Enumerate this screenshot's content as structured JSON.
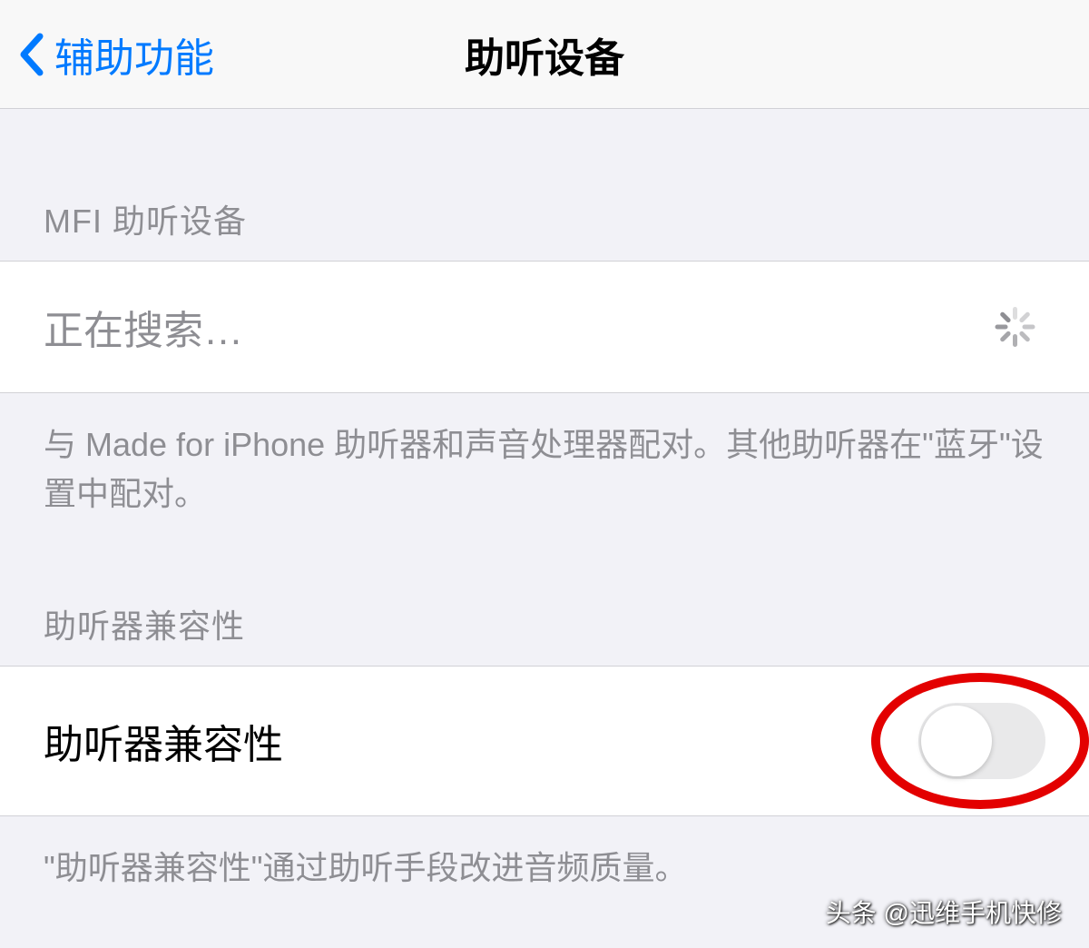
{
  "nav": {
    "back_label": "辅助功能",
    "title": "助听设备"
  },
  "section1": {
    "header": "MFI 助听设备",
    "searching_label": "正在搜索…",
    "footer": "与 Made for iPhone 助听器和声音处理器配对。其他助听器在\"蓝牙\"设置中配对。"
  },
  "section2": {
    "header": "助听器兼容性",
    "toggle_label": "助听器兼容性",
    "toggle_on": false,
    "footer": "\"助听器兼容性\"通过助听手段改进音频质量。"
  },
  "watermark": "头条 @迅维手机快修"
}
